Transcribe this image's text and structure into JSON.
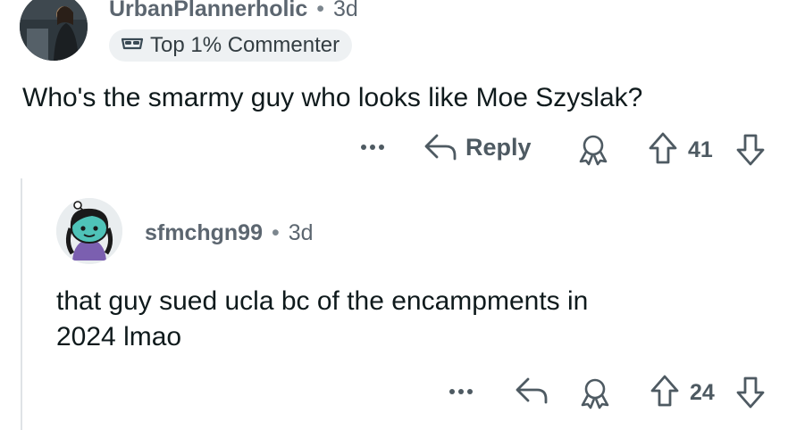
{
  "comment": {
    "username": "UrbanPlannerholic",
    "time": "3d",
    "badge_label": "Top 1% Commenter",
    "body": "Who's the smarmy guy who looks like Moe Szyslak?",
    "reply_label": "Reply",
    "score": "41"
  },
  "reply": {
    "username": "sfmchgn99",
    "time": "3d",
    "body_line1": "that guy sued ucla bc of the encampments in",
    "body_line2": "2024 lmao",
    "score": "24"
  },
  "separator": "•",
  "colors": {
    "icon": "#4e5a62",
    "badge_bg": "#eef1f3",
    "thread_line": "#dfe3e6",
    "avatar_teal": "#4fc3b8"
  },
  "icons": [
    "more-icon",
    "reply-arrow-icon",
    "award-icon",
    "upvote-icon",
    "downvote-icon",
    "badge-icon"
  ]
}
